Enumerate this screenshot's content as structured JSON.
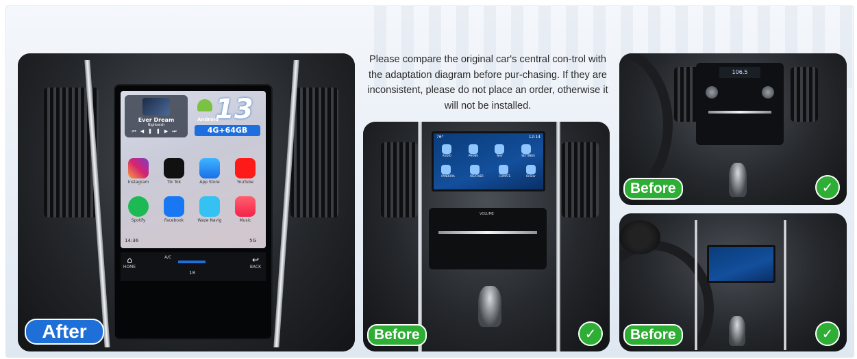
{
  "notice": "Please compare the original car's central con-trol with the adaptation diagram before pur-chasing. If they are inconsistent, please do not place an order, otherwise it will not be installed.",
  "after_panel": {
    "tag": "After",
    "screen": {
      "song_title": "Ever Dream",
      "song_artist": "Nightwish",
      "android_label": "Android",
      "version": "13",
      "memory": "4G+64GB",
      "apps": [
        "Instagram",
        "Tik Tok",
        "App Store",
        "YouTube",
        "Spotify",
        "Facebook",
        "Waze Navig",
        "Music"
      ],
      "clock": "14:36",
      "signal": "5G",
      "ac_label": "A/C",
      "temperature": "18",
      "home_label": "HOME",
      "back_label": "BACK"
    }
  },
  "before_main": {
    "tag": "Before",
    "screen_temp": "76°",
    "screen_time": "12:14",
    "apps_row1": [
      "AUDIO",
      "PHONE",
      "NAV",
      "SETTINGS"
    ],
    "apps_row2": [
      "PANDORA",
      "WEATHER",
      "CLIMATE",
      "OnStar"
    ],
    "volume_label": "VOLUME"
  },
  "before_top": {
    "tag": "Before",
    "display": "106.5"
  },
  "before_bottom": {
    "tag": "Before"
  },
  "colors": {
    "tag_after": "#1f6fd8",
    "tag_before": "#2fae35",
    "check": "#2fae35"
  },
  "icons": [
    "checkmark-icon",
    "android-icon",
    "home-icon",
    "back-icon"
  ]
}
